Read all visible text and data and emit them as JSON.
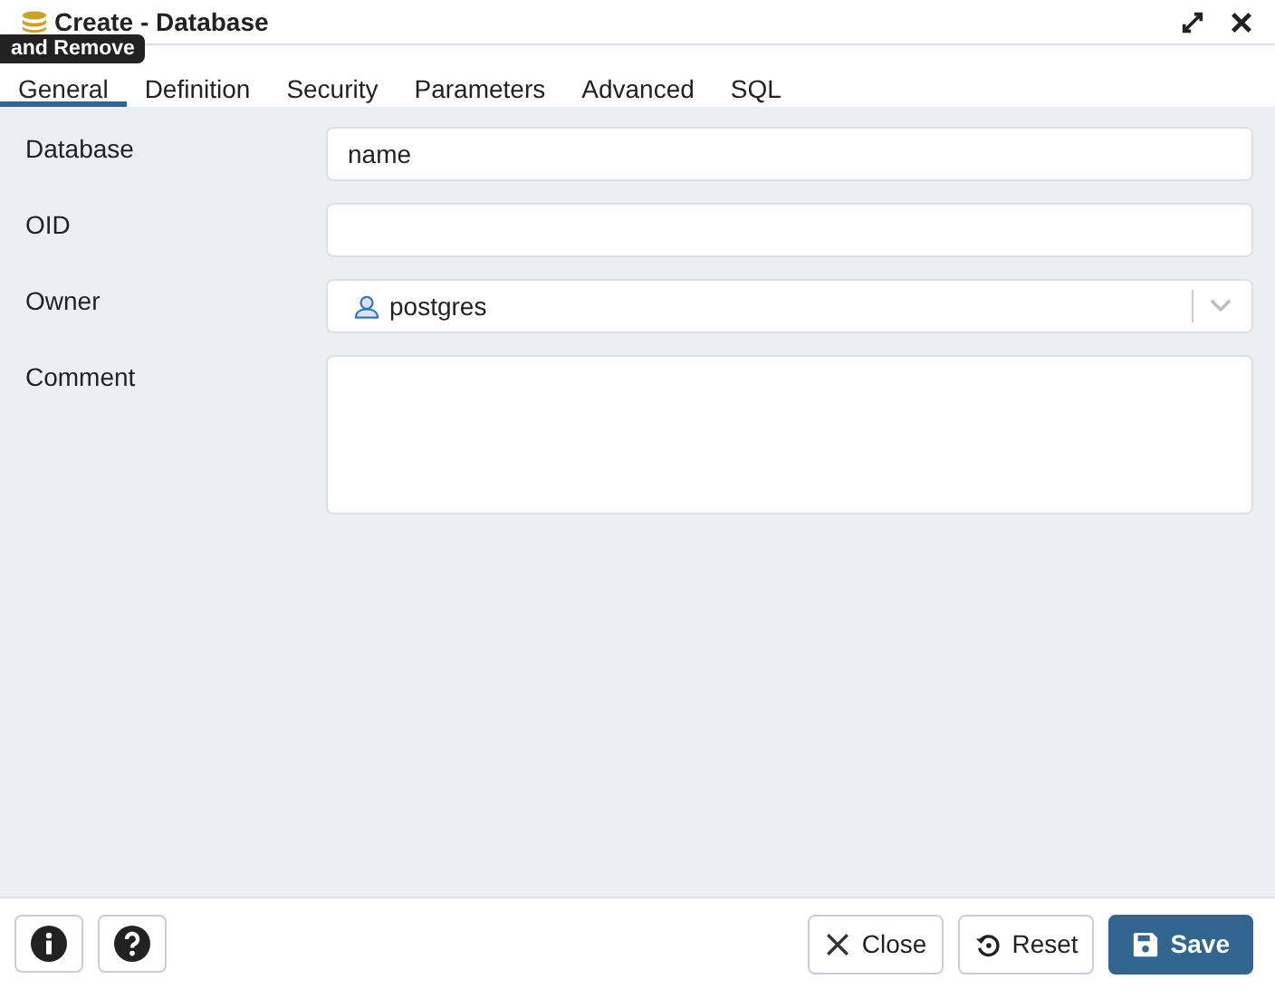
{
  "window": {
    "title": "Create - Database"
  },
  "tooltip": "and Remove",
  "tabs": [
    {
      "label": "General",
      "selected": true
    },
    {
      "label": "Definition",
      "selected": false
    },
    {
      "label": "Security",
      "selected": false
    },
    {
      "label": "Parameters",
      "selected": false
    },
    {
      "label": "Advanced",
      "selected": false
    },
    {
      "label": "SQL",
      "selected": false
    }
  ],
  "fields": [
    {
      "label": "Database",
      "kind": "text",
      "value": "name"
    },
    {
      "label": "OID",
      "kind": "text"
    },
    {
      "label": "Owner",
      "kind": "select",
      "value": "postgres"
    },
    {
      "label": "Comment",
      "kind": "textarea"
    }
  ],
  "buttons": [
    {
      "label": "Close",
      "kind": "close"
    },
    {
      "label": "Reset",
      "kind": "reset"
    },
    {
      "label": "Save",
      "kind": "save"
    }
  ]
}
